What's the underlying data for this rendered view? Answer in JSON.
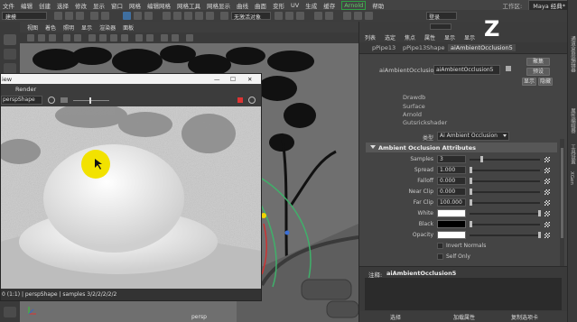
{
  "menubar": {
    "items": [
      "文件",
      "编辑",
      "创建",
      "选择",
      "修改",
      "显示",
      "窗口",
      "网格",
      "编辑网格",
      "网格工具",
      "网格显示",
      "曲线",
      "曲面",
      "变形",
      "UV",
      "生成",
      "缓存",
      "Arnold",
      "帮助"
    ],
    "workspace_label": "工作区:",
    "workspace_value": "Maya 经典*"
  },
  "status": {
    "mode": "建模",
    "symmetry": "无激活对象",
    "login": "登录"
  },
  "viewport": {
    "tabs": [
      "视图",
      "着色",
      "照明",
      "显示",
      "渲染器",
      "面板"
    ],
    "camera_label": "persp"
  },
  "render_view": {
    "title_suffix": "iew",
    "menu": [
      "Render"
    ],
    "camera": "perspShape",
    "status": "0 (1:1)  |  perspShape  |  samples 3/2/2/2/2/2"
  },
  "ae": {
    "tabs": [
      "列表",
      "选定",
      "焦点",
      "属性",
      "显示",
      "显示"
    ],
    "nodes": [
      "pPipe13",
      "pPipe13Shape",
      "aiAmbientOcclusion5"
    ],
    "node_type_label": "aiAmbientOcclusion:",
    "node_name": "aiAmbientOcclusion5",
    "buttons": [
      "聚集",
      "预设",
      "显示",
      "隐藏"
    ],
    "classification": [
      "Drawdb",
      "Surface",
      "Arnold",
      "Gutsrickshader"
    ],
    "type_label": "类型",
    "type_value": "Ai Ambient Occlusion",
    "section_title": "Ambient Occlusion Attributes",
    "attrs": [
      {
        "label": "Samples",
        "value": "3",
        "fill": 0.15
      },
      {
        "label": "Spread",
        "value": "1.000",
        "fill": 0.0
      },
      {
        "label": "Falloff",
        "value": "0.000",
        "fill": 0.0
      },
      {
        "label": "Near Clip",
        "value": "0.000",
        "fill": 0.0
      },
      {
        "label": "Far Clip",
        "value": "100.000",
        "fill": 0.0
      }
    ],
    "colors": [
      {
        "label": "White",
        "color": "#ffffff",
        "fill": 0.98
      },
      {
        "label": "Black",
        "color": "#000000",
        "fill": 0.0
      },
      {
        "label": "Opacity",
        "color": "#ffffff",
        "fill": 0.98
      }
    ],
    "checks": [
      "Invert Normals",
      "Self Only"
    ],
    "notes_label": "注释:",
    "notes_node": "aiAmbientOcclusion5",
    "bottom": [
      "选择",
      "加载属性",
      "复制选项卡"
    ]
  },
  "right_strip": [
    "通道盒/层编辑器",
    "属性编辑器",
    "工具设置",
    "XGen"
  ],
  "logo_text": "Z",
  "accent_color": "#3f6fa0",
  "cursor_highlight_color": "#f2e200"
}
